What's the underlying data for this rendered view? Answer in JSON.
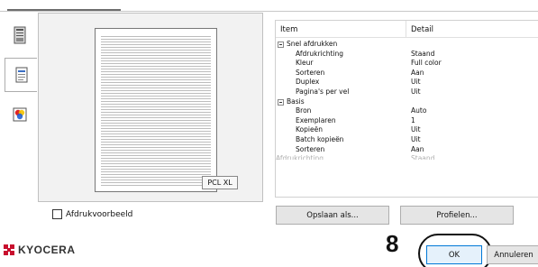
{
  "sidebar": {
    "tabs": [
      {
        "icon": "printer-icon"
      },
      {
        "icon": "document-icon"
      },
      {
        "icon": "color-icon"
      }
    ]
  },
  "preview": {
    "badge": "PCL XL",
    "checkbox_label": "Afdrukvoorbeeld",
    "checkbox_checked": false
  },
  "table": {
    "headers": {
      "item": "Item",
      "detail": "Detail"
    },
    "rows": [
      {
        "type": "group",
        "name": "Snel afdrukken",
        "value": ""
      },
      {
        "type": "leaf",
        "name": "Afdrukrichting",
        "value": "Staand"
      },
      {
        "type": "leaf",
        "name": "Kleur",
        "value": "Full color"
      },
      {
        "type": "leaf",
        "name": "Sorteren",
        "value": "Aan"
      },
      {
        "type": "leaf",
        "name": "Duplex",
        "value": "Uit"
      },
      {
        "type": "leaf",
        "name": "Pagina's per vel",
        "value": "Uit"
      },
      {
        "type": "group",
        "name": "Basis",
        "value": ""
      },
      {
        "type": "leaf",
        "name": "Bron",
        "value": "Auto"
      },
      {
        "type": "leaf",
        "name": "Exemplaren",
        "value": "1"
      },
      {
        "type": "leaf",
        "name": "Kopieën",
        "value": "Uit"
      },
      {
        "type": "leaf",
        "name": "Batch kopieën",
        "value": "Uit"
      },
      {
        "type": "leaf",
        "name": "Sorteren",
        "value": "Aan"
      },
      {
        "type": "cut",
        "name": "Afdrukrichting",
        "value": "Staand"
      }
    ]
  },
  "buttons": {
    "save": "Opslaan als...",
    "profiles": "Profielen...",
    "ok": "OK",
    "cancel": "Annuleren"
  },
  "callout": {
    "step": "8"
  },
  "brand": {
    "name": "KYOCERA",
    "color": "#c8102e"
  }
}
